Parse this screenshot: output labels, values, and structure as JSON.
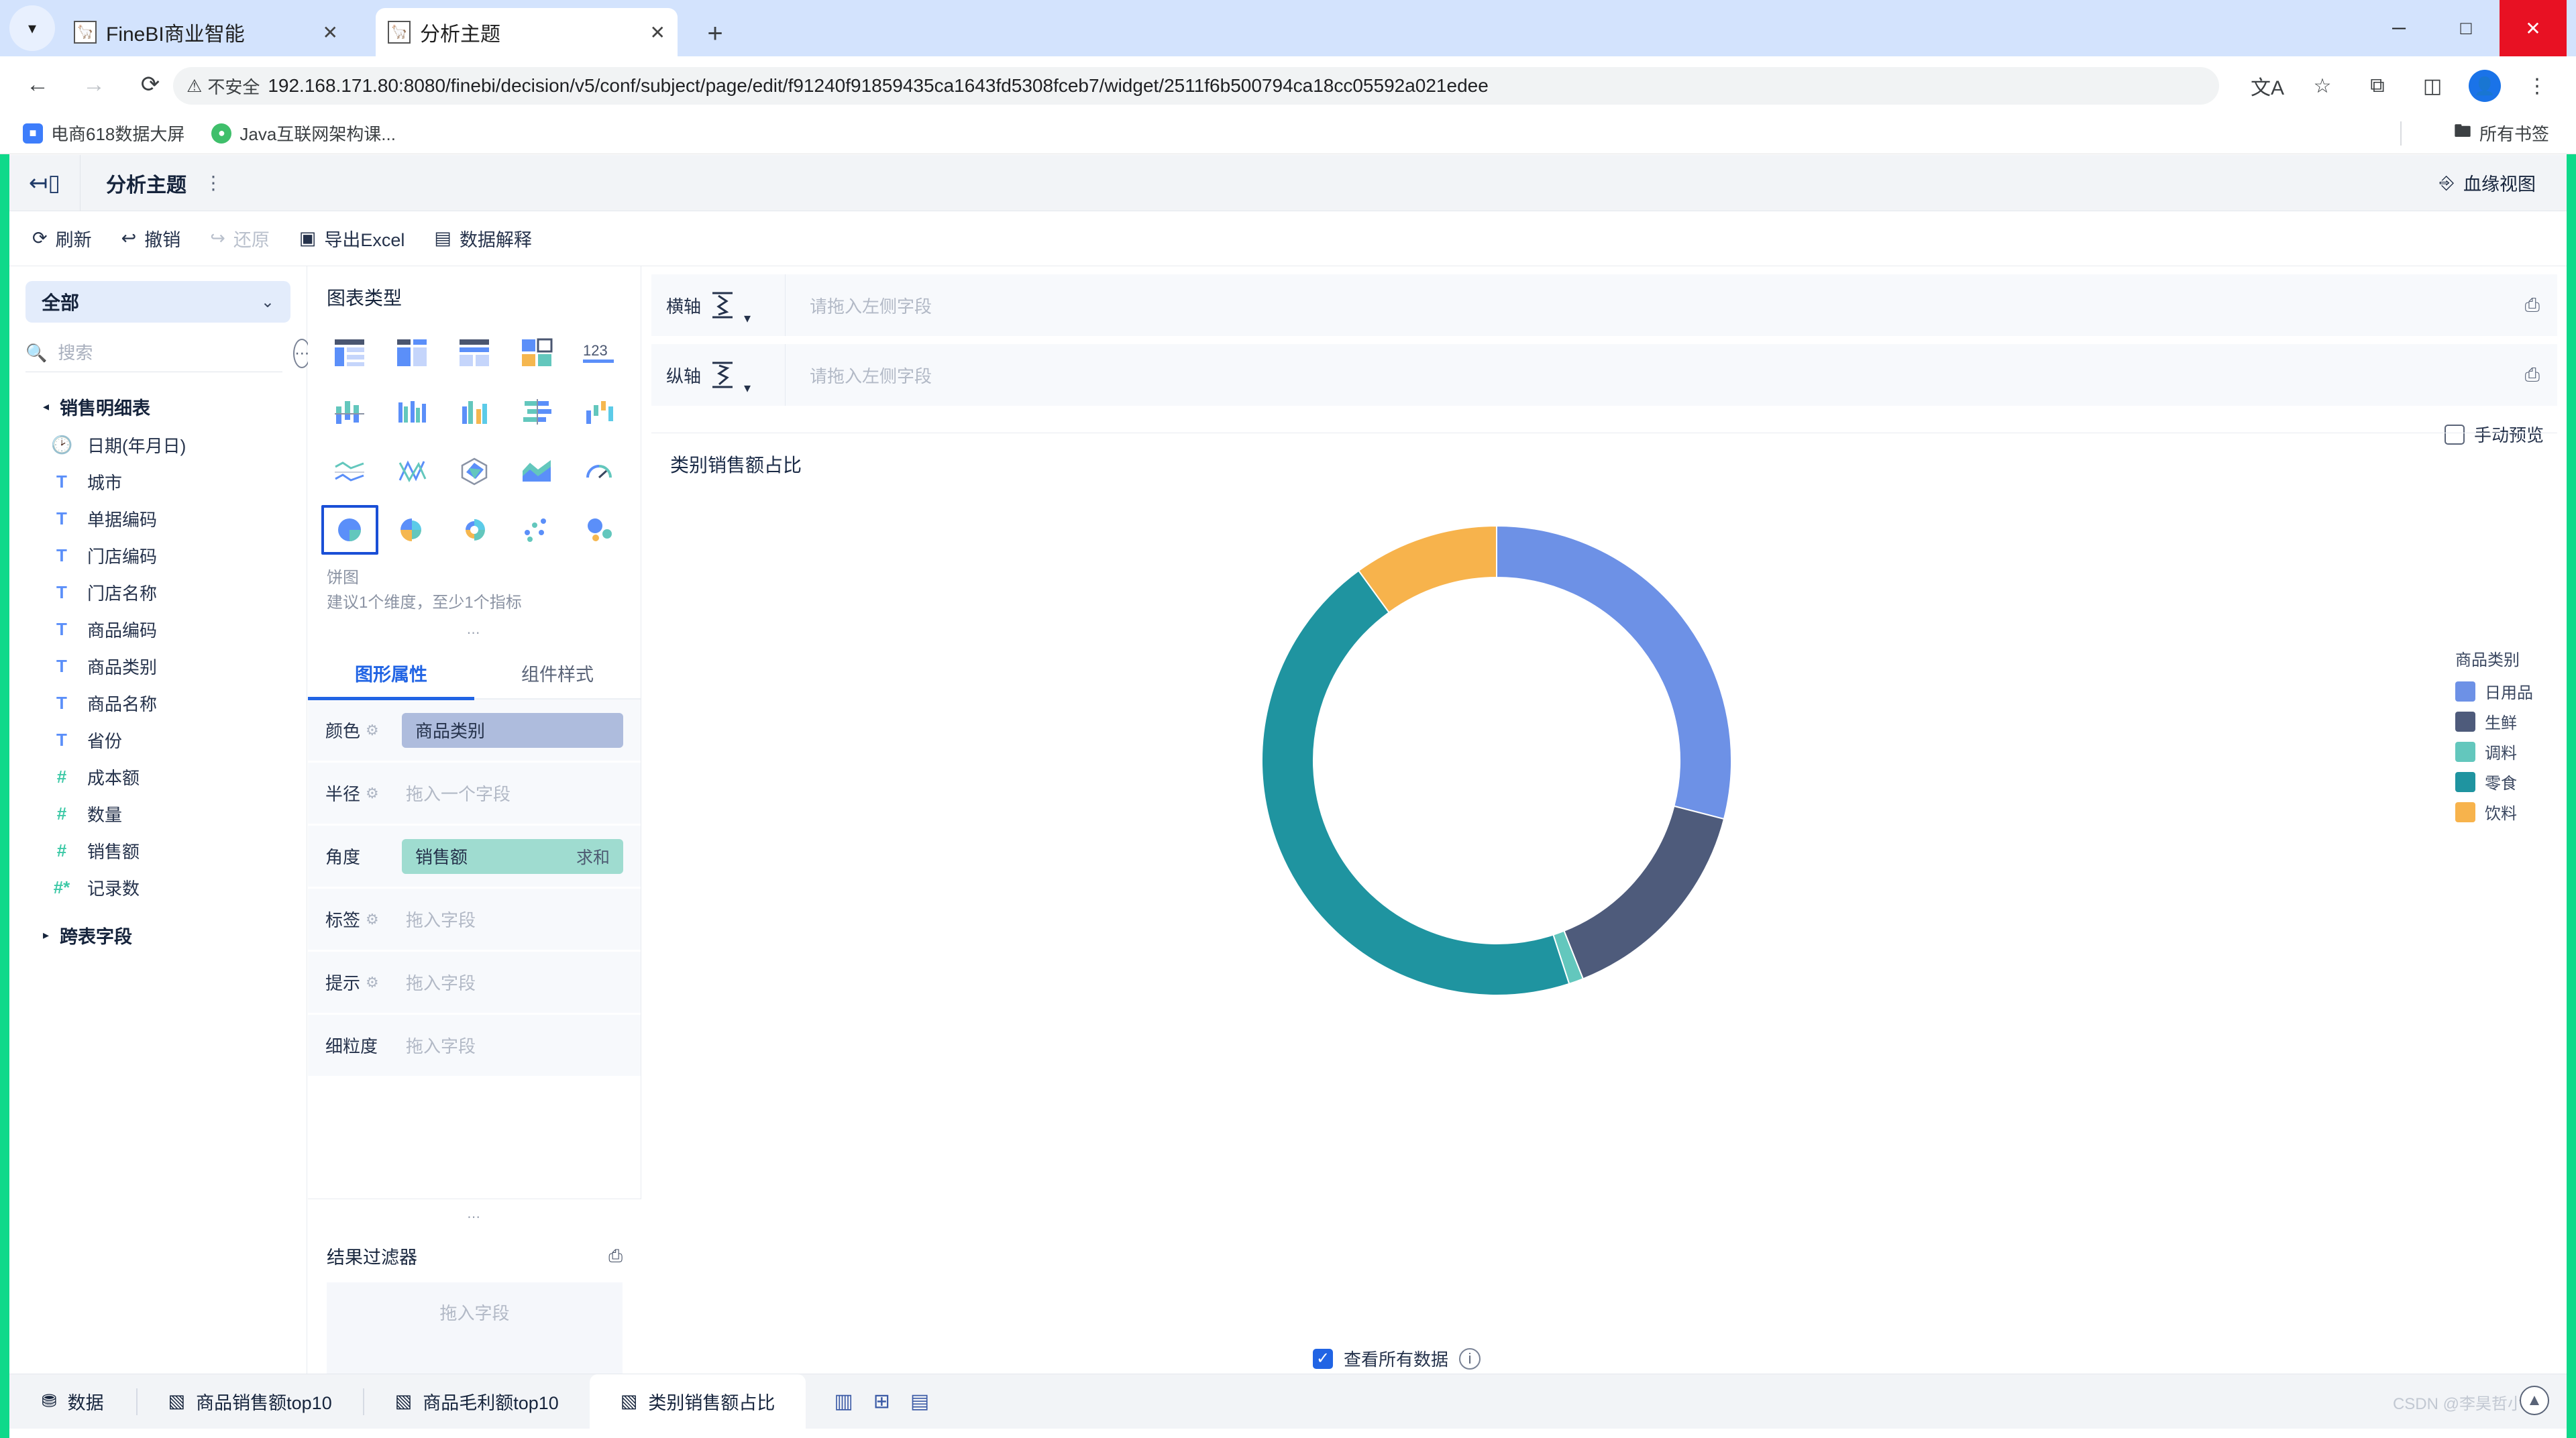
{
  "browser": {
    "tabs": [
      {
        "title": "FineBI商业智能",
        "active": false,
        "close": "✕"
      },
      {
        "title": "分析主题",
        "active": true,
        "close": "✕"
      }
    ],
    "newtab": "+",
    "window_controls": {
      "minimize": "─",
      "maximize": "□",
      "close": "✕"
    },
    "nav": {
      "back": "←",
      "forward": "→",
      "reload": "⟳"
    },
    "security_label": "不安全",
    "url": "192.168.171.80:8080/finebi/decision/v5/conf/subject/page/edit/f91240f91859435ca1643fd5308fceb7/widget/2511f6b500794ca18cc05592a021edee",
    "toolbar_right": {
      "translate": "文A",
      "star": "☆",
      "extensions": "⧉",
      "sidepanel": "◫",
      "profile": "●",
      "menu": "⋮"
    },
    "bookmarks": [
      {
        "label": "电商618数据大屏",
        "color": "#3d7dfb"
      },
      {
        "label": "Java互联网架构课...",
        "color": "#3fbf6b"
      }
    ],
    "bookmarks_all": "所有书签",
    "folder_icon": "▢"
  },
  "header": {
    "back_icon": "exit-icon",
    "title": "分析主题",
    "more": "⋮",
    "lineage_label": "血缘视图"
  },
  "toolbar": {
    "items": [
      {
        "label": "刷新",
        "icon": "⟳",
        "disabled": false
      },
      {
        "label": "撤销",
        "icon": "↩",
        "disabled": false
      },
      {
        "label": "还原",
        "icon": "↪",
        "disabled": true
      },
      {
        "label": "导出Excel",
        "icon": "⌧",
        "disabled": false
      },
      {
        "label": "数据解释",
        "icon": "▤",
        "disabled": false
      }
    ]
  },
  "fields_panel": {
    "selector_label": "全部",
    "selector_caret": "⌄",
    "search_placeholder": "搜索",
    "search_value": "",
    "more_icon": "⋯",
    "groups": [
      {
        "name": "销售明细表",
        "expanded": true,
        "caret": "◂",
        "fields": [
          {
            "label": "日期(年月日)",
            "type": "date",
            "glyph": "◔"
          },
          {
            "label": "城市",
            "type": "text",
            "glyph": "T"
          },
          {
            "label": "单据编码",
            "type": "text",
            "glyph": "T"
          },
          {
            "label": "门店编码",
            "type": "text",
            "glyph": "T"
          },
          {
            "label": "门店名称",
            "type": "text",
            "glyph": "T"
          },
          {
            "label": "商品编码",
            "type": "text",
            "glyph": "T"
          },
          {
            "label": "商品类别",
            "type": "text",
            "glyph": "T"
          },
          {
            "label": "商品名称",
            "type": "text",
            "glyph": "T"
          },
          {
            "label": "省份",
            "type": "text",
            "glyph": "T"
          },
          {
            "label": "成本额",
            "type": "number",
            "glyph": "#"
          },
          {
            "label": "数量",
            "type": "number",
            "glyph": "#"
          },
          {
            "label": "销售额",
            "type": "number",
            "glyph": "#"
          },
          {
            "label": "记录数",
            "type": "count",
            "glyph": "#*"
          }
        ]
      },
      {
        "name": "跨表字段",
        "expanded": false,
        "caret": "▸",
        "fields": []
      }
    ]
  },
  "chart_type_panel": {
    "title": "图表类型",
    "selected_index": 15,
    "selected_name": "饼图",
    "selected_desc": "建议1个维度，至少1个指标",
    "cells": [
      {
        "name": "table-chart"
      },
      {
        "name": "group-table-chart"
      },
      {
        "name": "cross-table-chart"
      },
      {
        "name": "kpi-card-chart"
      },
      {
        "name": "number-chart"
      },
      {
        "name": "stacked-bar-chart"
      },
      {
        "name": "column-chart"
      },
      {
        "name": "grouped-column-chart"
      },
      {
        "name": "horizontal-bar-chart"
      },
      {
        "name": "waterfall-chart"
      },
      {
        "name": "line-chart"
      },
      {
        "name": "combo-chart"
      },
      {
        "name": "radar-chart"
      },
      {
        "name": "area-chart"
      },
      {
        "name": "gauge-chart"
      },
      {
        "name": "pie-chart"
      },
      {
        "name": "rose-chart"
      },
      {
        "name": "multi-ring-chart"
      },
      {
        "name": "scatter-chart"
      },
      {
        "name": "bubble-chart"
      }
    ]
  },
  "properties_panel": {
    "tabs": [
      {
        "label": "图形属性",
        "active": true
      },
      {
        "label": "组件样式",
        "active": false
      }
    ],
    "rows": [
      {
        "label": "颜色",
        "gear": true,
        "pill": {
          "text": "商品类别",
          "sub": "",
          "kind": "dim"
        },
        "placeholder": ""
      },
      {
        "label": "半径",
        "gear": true,
        "pill": null,
        "placeholder": "拖入一个字段"
      },
      {
        "label": "角度",
        "gear": false,
        "pill": {
          "text": "销售额",
          "sub": "求和",
          "kind": "agg"
        },
        "placeholder": ""
      },
      {
        "label": "标签",
        "gear": true,
        "pill": null,
        "placeholder": "拖入字段"
      },
      {
        "label": "提示",
        "gear": true,
        "pill": null,
        "placeholder": "拖入字段"
      },
      {
        "label": "细粒度",
        "gear": false,
        "pill": null,
        "placeholder": "拖入字段"
      }
    ]
  },
  "result_filter": {
    "title": "结果过滤器",
    "icon": "⎙",
    "drop_placeholder": "拖入字段"
  },
  "shelves": [
    {
      "label": "横轴",
      "icon": "x-axis-icon",
      "placeholder": "请拖入左侧字段",
      "caret": "▾"
    },
    {
      "label": "纵轴",
      "icon": "y-axis-icon",
      "placeholder": "请拖入左侧字段",
      "caret": "▾"
    }
  ],
  "preview": {
    "label": "手动预览",
    "checked": false
  },
  "view_all_data": {
    "label": "查看所有数据",
    "checked": true,
    "info": "i"
  },
  "chart_data": {
    "type": "pie",
    "variant": "donut",
    "title": "类别销售额占比",
    "legend_title": "商品类别",
    "legend_position": "right",
    "categories": [
      "日用品",
      "生鲜",
      "调料",
      "零食",
      "饮料"
    ],
    "values": [
      29.0,
      15.0,
      1.0,
      45.0,
      10.0
    ],
    "unit": "%",
    "colors": [
      "#6D91E6",
      "#4E5B7B",
      "#63C7BD",
      "#1F94A0",
      "#F7B34C"
    ],
    "inner_radius_ratio": 0.78,
    "start_angle": 0,
    "direction": "clockwise",
    "xlabel": "",
    "ylabel": ""
  },
  "bottom_bar": {
    "data_label": "数据",
    "data_icon": "⛃",
    "tabs": [
      {
        "label": "商品销售额top10",
        "active": false
      },
      {
        "label": "商品毛利额top10",
        "active": false
      },
      {
        "label": "类别销售额占比",
        "active": true
      }
    ],
    "action_icons": [
      {
        "name": "add-chart-icon",
        "glyph": "▥"
      },
      {
        "name": "add-component-icon",
        "glyph": "⊞"
      },
      {
        "name": "add-filter-icon",
        "glyph": "▤"
      }
    ]
  },
  "watermark": "CSDN @李昊哲小课"
}
